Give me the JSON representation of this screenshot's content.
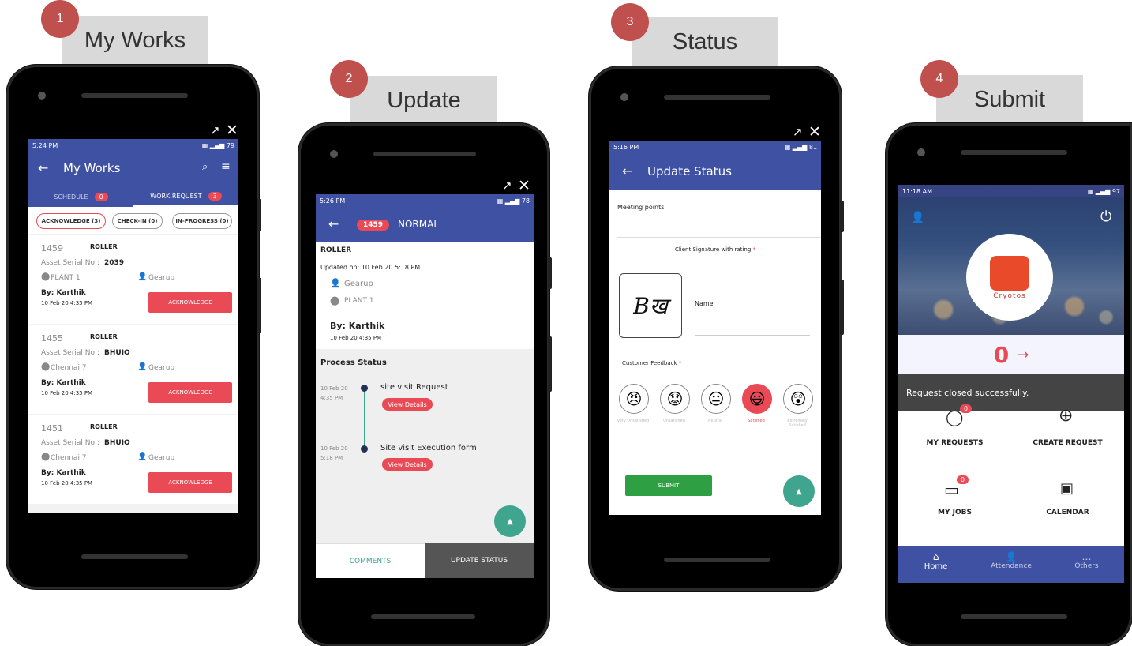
{
  "steps": [
    {
      "number": "1",
      "label": "My Works"
    },
    {
      "number": "2",
      "label": "Update"
    },
    {
      "number": "3",
      "label": "Status"
    },
    {
      "number": "4",
      "label": "Submit"
    }
  ],
  "screen1": {
    "time": "5:24 PM",
    "battery": "79",
    "title": "My Works",
    "tabs": [
      {
        "label": "SCHEDULE",
        "count": "0"
      },
      {
        "label": "WORK REQUEST",
        "count": "3"
      }
    ],
    "filters": [
      "ACKNOWLEDGE (3)",
      "CHECK-IN (0)",
      "IN-PROGRESS (0)"
    ],
    "items": [
      {
        "id": "1459",
        "type": "ROLLER",
        "serial_label": "Asset Serial No :",
        "serial": "2039",
        "location": "PLANT 1",
        "company": "Gearup",
        "by": "By: Karthik",
        "date": "10 Feb 20 4:35 PM",
        "action": "ACKNOWLEDGE"
      },
      {
        "id": "1455",
        "type": "ROLLER",
        "serial_label": "Asset Serial No :",
        "serial": "BHUIO",
        "location": "Chennai 7",
        "company": "Gearup",
        "by": "By: Karthik",
        "date": "10 Feb 20 4:35 PM",
        "action": "ACKNOWLEDGE"
      },
      {
        "id": "1451",
        "type": "ROLLER",
        "serial_label": "Asset Serial No :",
        "serial": "BHUIO",
        "location": "Chennai 7",
        "company": "Gearup",
        "by": "By: Karthik",
        "date": "10 Feb 20 4:35 PM",
        "action": "ACKNOWLEDGE"
      }
    ]
  },
  "screen2": {
    "time": "5:26 PM",
    "battery": "78",
    "badge": "1459",
    "priority": "NORMAL",
    "type": "ROLLER",
    "updated": "Updated on: 10 Feb 20 5:18 PM",
    "company": "Gearup",
    "location": "PLANT 1",
    "by": "By: Karthik",
    "date": "10 Feb 20 4:35 PM",
    "process_title": "Process Status",
    "timeline": [
      {
        "date": "10 Feb 20",
        "time": "4:35 PM",
        "title": "site visit Request",
        "button": "View Details"
      },
      {
        "date": "10 Feb 20",
        "time": "5:18 PM",
        "title": "Site visit Execution form",
        "button": "View Details"
      }
    ],
    "bottom_left": "COMMENTS",
    "bottom_right": "UPDATE STATUS"
  },
  "screen3": {
    "time": "5:16 PM",
    "battery": "81",
    "title": "Update Status",
    "meeting_label": "Meeting points",
    "signature_label": "Client Signature with rating",
    "required": "*",
    "signature_text": "Bख",
    "name_label": "Name",
    "feedback_label": "Customer Feedback",
    "ratings": [
      {
        "emoji": "😠",
        "label": "Very Unsatisfied"
      },
      {
        "emoji": "😟",
        "label": "Unsatisfied"
      },
      {
        "emoji": "😐",
        "label": "Neutral"
      },
      {
        "emoji": "😃",
        "label": "Satisfied"
      },
      {
        "emoji": "😲",
        "label": "Extremely Satisfied"
      }
    ],
    "submit": "SUBMIT"
  },
  "screen4": {
    "time": "11:18 AM",
    "battery": "97",
    "logo_text": "Cryotos",
    "count": "0",
    "toast": "Request closed successfully.",
    "tiles": [
      {
        "label": "MY REQUESTS",
        "badge": "0"
      },
      {
        "label": "CREATE REQUEST",
        "badge": ""
      },
      {
        "label": "MY JOBS",
        "badge": "0"
      },
      {
        "label": "CALENDAR",
        "badge": ""
      }
    ],
    "nav": [
      "Home",
      "Attendance",
      "Others"
    ]
  },
  "colors": {
    "header": "#3f51a3",
    "accent": "#e94a55",
    "teal": "#3fa58e",
    "green": "#2ea043"
  }
}
